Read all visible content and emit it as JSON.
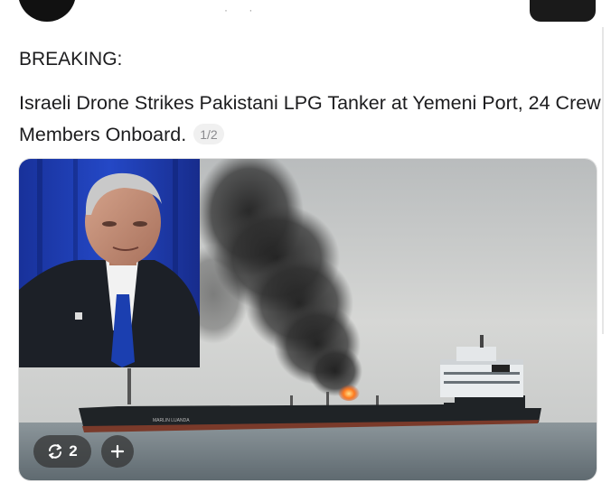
{
  "post": {
    "label": "BREAKING:",
    "headline": "Israeli Drone Strikes Pakistani LPG Tanker at Yemeni Port, 24 Crew Members Onboard.",
    "image_counter": "1/2"
  },
  "media": {
    "ship_name": "MARLIN LUANDA",
    "icons": [
      "repost-icon",
      "plus-icon"
    ]
  },
  "actions": {
    "repost_count": "2"
  },
  "colors": {
    "text": "#1c1c1e",
    "smoke": "#2b2b2b",
    "fire": "#ff6a1a",
    "hull": "#1f2326",
    "sea": "#6f7a80"
  }
}
